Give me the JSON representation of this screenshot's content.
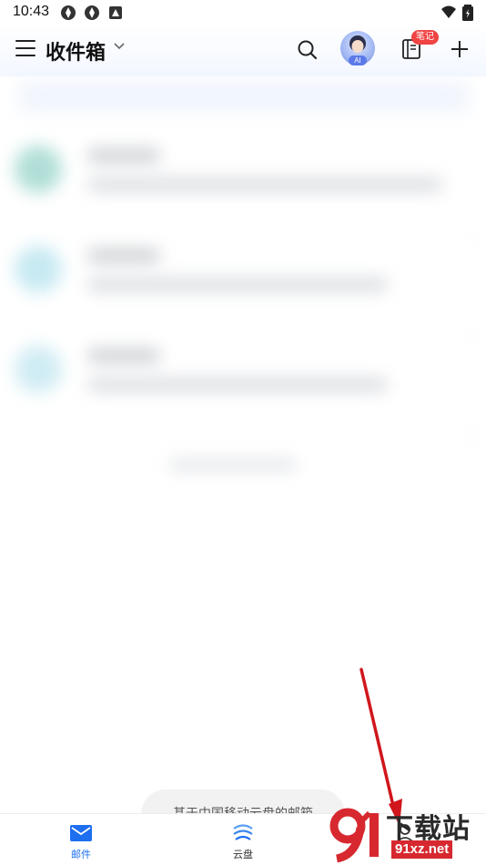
{
  "status_bar": {
    "time": "10:43"
  },
  "header": {
    "title": "收件箱",
    "ai_avatar_label": "AI",
    "notes_badge": "笔记"
  },
  "toast": {
    "text": "基于中国移动云盘的邮箱"
  },
  "bottom_nav": {
    "items": [
      {
        "label": "邮件",
        "icon": "mail-icon",
        "active": true
      },
      {
        "label": "云盘",
        "icon": "cloud-drive-icon",
        "active": false
      },
      {
        "label": "",
        "icon": "profile-icon",
        "active": false
      }
    ]
  },
  "watermark": {
    "brand": "下载站",
    "url": "91xz.net"
  },
  "colors": {
    "accent": "#1e6ff0",
    "badge": "#f04343",
    "annotation_arrow": "#d0161c"
  }
}
